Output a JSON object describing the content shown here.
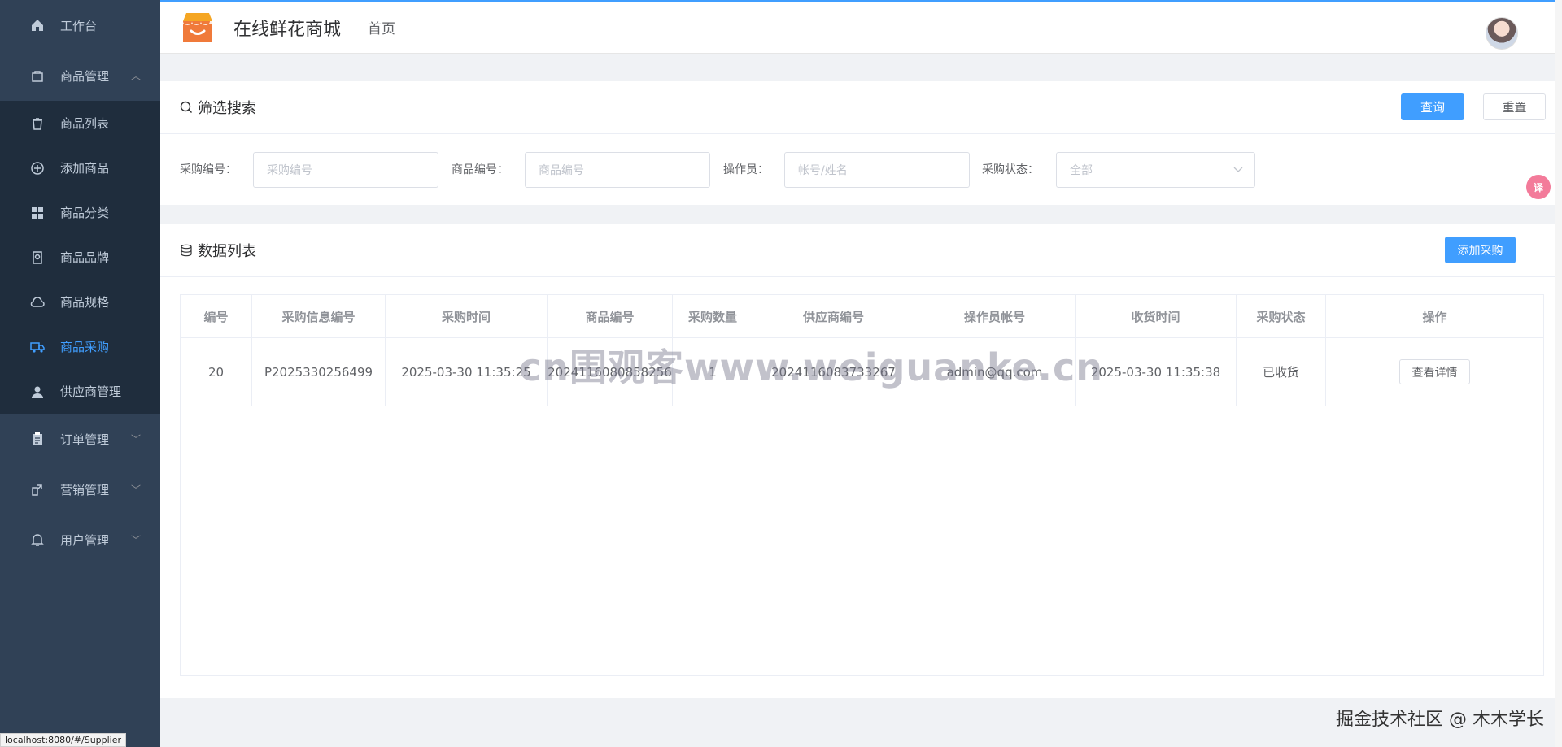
{
  "sidebar": {
    "items": [
      {
        "label": "工作台",
        "icon": "home-icon"
      },
      {
        "label": "商品管理",
        "icon": "bag-icon",
        "expanded": true
      },
      {
        "label": "商品列表",
        "icon": "trash-icon"
      },
      {
        "label": "添加商品",
        "icon": "plus-circle-icon"
      },
      {
        "label": "商品分类",
        "icon": "grid-icon"
      },
      {
        "label": "商品品牌",
        "icon": "badge-icon"
      },
      {
        "label": "商品规格",
        "icon": "cloud-icon"
      },
      {
        "label": "商品采购",
        "icon": "truck-icon",
        "active": true
      },
      {
        "label": "供应商管理",
        "icon": "user-icon"
      },
      {
        "label": "订单管理",
        "icon": "clipboard-icon"
      },
      {
        "label": "营销管理",
        "icon": "share-icon"
      },
      {
        "label": "用户管理",
        "icon": "bell-icon"
      }
    ],
    "status_url": "localhost:8080/#/Supplier"
  },
  "header": {
    "site_title": "在线鲜花商城",
    "nav_home": "首页"
  },
  "filter": {
    "title": "筛选搜索",
    "query_btn": "查询",
    "reset_btn": "重置",
    "fields": [
      {
        "label": "采购编号：",
        "placeholder": "采购编号"
      },
      {
        "label": "商品编号：",
        "placeholder": "商品编号"
      },
      {
        "label": "操作员：",
        "placeholder": "帐号/姓名"
      },
      {
        "label": "采购状态：",
        "placeholder": "全部"
      }
    ]
  },
  "list": {
    "title": "数据列表",
    "add_btn": "添加采购",
    "columns": [
      "编号",
      "采购信息编号",
      "采购时间",
      "商品编号",
      "采购数量",
      "供应商编号",
      "操作员帐号",
      "收货时间",
      "采购状态",
      "操作"
    ],
    "rows": [
      [
        "20",
        "P2025330256499",
        "2025-03-30 11:35:25",
        "2024116080858256",
        "1",
        "2024116083733267",
        "admin@qq.com",
        "2025-03-30 11:35:38",
        "已收货",
        "查看详情"
      ]
    ]
  },
  "watermark": "cn围观客www.weiguanke.cn",
  "footer_credit": "掘金技术社区 @ 木木学长",
  "colors": {
    "primary": "#409eff",
    "sidebar_bg": "#304156",
    "submenu_bg": "#1f2d3d"
  }
}
